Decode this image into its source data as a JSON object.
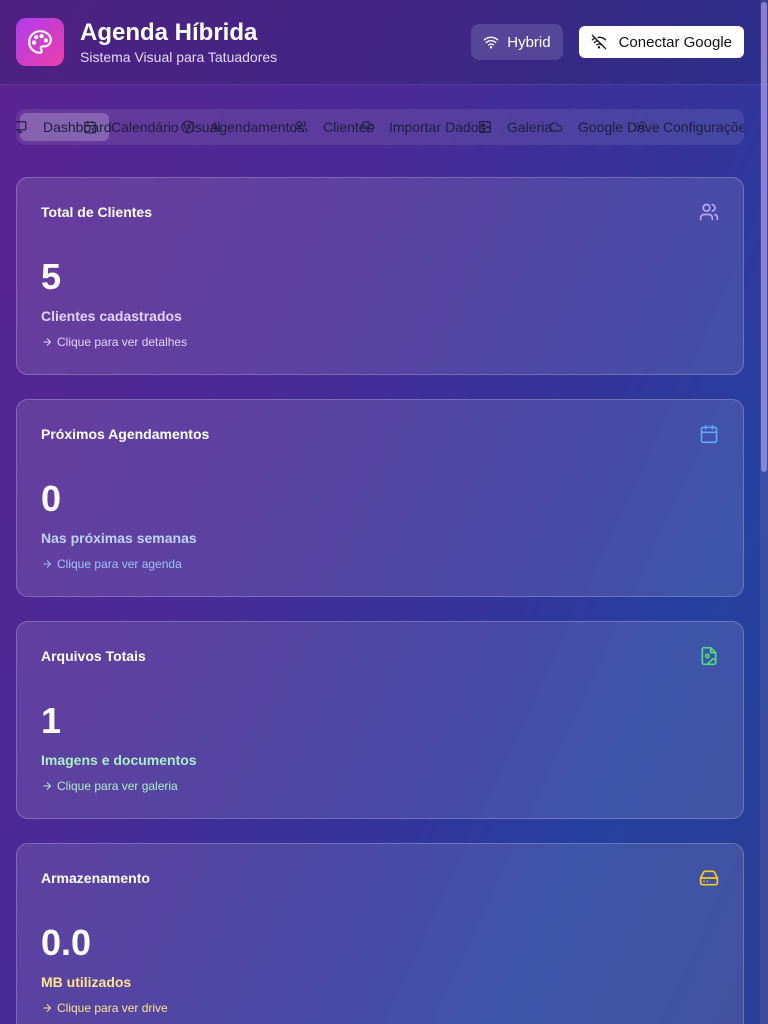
{
  "header": {
    "title": "Agenda Híbrida",
    "subtitle": "Sistema Visual para Tatuadores",
    "mode_label": "Hybrid",
    "google_label": "Conectar Google",
    "logo_icon": "palette-icon"
  },
  "nav": {
    "tabs": [
      {
        "label": "Dashboard",
        "icon": "monitor-icon",
        "active": true
      },
      {
        "label": "Calendário Visual",
        "icon": "calendar-icon"
      },
      {
        "label": "Agendamentos",
        "icon": "clock-icon"
      },
      {
        "label": "Clientes",
        "icon": "users-icon"
      },
      {
        "label": "Importar Dados",
        "icon": "cloud-upload-icon"
      },
      {
        "label": "Galeria",
        "icon": "image-icon"
      },
      {
        "label": "Google Drive",
        "icon": "cloud-icon"
      },
      {
        "label": "Configurações",
        "icon": "settings-icon"
      }
    ]
  },
  "cards": [
    {
      "title": "Total de Clientes",
      "value": "5",
      "subtitle": "Clientes cadastrados",
      "link": "Clique para ver detalhes",
      "icon": "users-icon",
      "accent": "#c4a5fa"
    },
    {
      "title": "Próximos Agendamentos",
      "value": "0",
      "subtitle": "Nas próximas semanas",
      "link": "Clique para ver agenda",
      "icon": "calendar-icon",
      "accent": "#60a5fa"
    },
    {
      "title": "Arquivos Totais",
      "value": "1",
      "subtitle": "Imagens e documentos",
      "link": "Clique para ver galeria",
      "icon": "file-image-icon",
      "accent": "#4ade80"
    },
    {
      "title": "Armazenamento",
      "value": "0.0",
      "subtitle": "MB utilizados",
      "link": "Clique para ver drive",
      "icon": "hard-drive-icon",
      "accent": "#facc15"
    }
  ]
}
